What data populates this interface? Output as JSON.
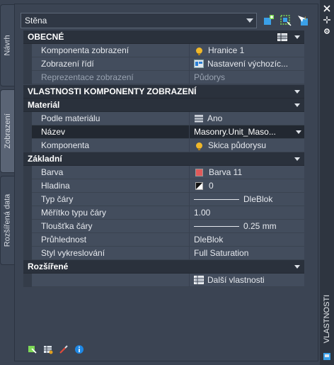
{
  "tabs": [
    {
      "label": "Návrh"
    },
    {
      "label": "Zobrazení"
    },
    {
      "label": "Rozšířená data"
    }
  ],
  "style_select": {
    "value": "Stěna"
  },
  "sections": {
    "general": "OBECNÉ",
    "display_props": "VLASTNOSTI KOMPONENTY ZOBRAZENÍ",
    "material": "Materiál",
    "basic": "Základní",
    "extended": "Rozšířené"
  },
  "general_rows": [
    {
      "label": "Komponenta zobrazení",
      "value": "Hranice 1"
    },
    {
      "label": "Zobrazení řídí",
      "value": "Nastavení výchozíc..."
    },
    {
      "label": "Reprezentace zobrazení",
      "value": "Půdorys"
    }
  ],
  "material_rows": [
    {
      "label": "Podle materiálu",
      "value": "Ano"
    },
    {
      "label": "Název",
      "value": "Masonry.Unit_Maso..."
    },
    {
      "label": "Komponenta",
      "value": "Skica půdorysu"
    }
  ],
  "basic_rows": [
    {
      "label": "Barva",
      "value": "Barva 11"
    },
    {
      "label": "Hladina",
      "value": "0"
    },
    {
      "label": "Typ čáry",
      "value": "DleBlok"
    },
    {
      "label": "Měřítko typu čáry",
      "value": "1.00"
    },
    {
      "label": "Tloušťka čáry",
      "value": "0.25 mm"
    },
    {
      "label": "Průhlednost",
      "value": "DleBlok"
    },
    {
      "label": "Styl vykreslování",
      "value": "Full Saturation"
    }
  ],
  "extended_rows": [
    {
      "label": "",
      "value": "Další vlastnosti"
    }
  ],
  "right_strip": {
    "title": "VLASTNOSTI"
  },
  "colors": {
    "accent": "#1e88e5",
    "color_swatch": "#e05a5a",
    "bulb": "#f0b82a"
  }
}
